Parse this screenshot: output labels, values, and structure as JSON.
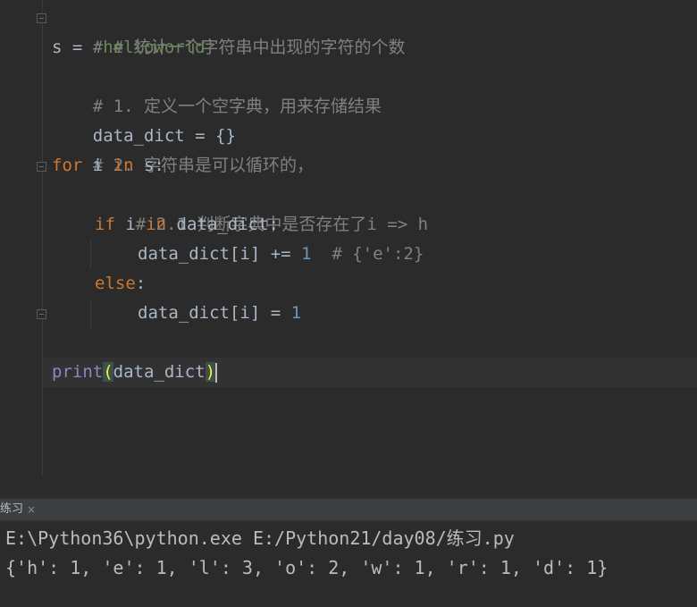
{
  "editor": {
    "lines": [
      {
        "comment": "# # 统计一个字符串中出现的字符的个数"
      },
      {
        "var": "s",
        "op": " = ",
        "str": "'helloworld'"
      },
      {
        "comment": "# 1. 定义一个空字典，用来存储结果"
      },
      {
        "text": "data_dict = {}"
      },
      {
        "comment": "# 2. 字符串是可以循环的，"
      },
      {
        "kw1": "for",
        "mid": " i ",
        "kw2": "in",
        "rest": " s:"
      },
      {
        "comment": "# 2.1 判断字典中是否存在了i => h"
      },
      {
        "kw1": "if",
        "mid": " i ",
        "kw2": "in",
        "rest": " data_dict:"
      },
      {
        "pre": "data_dict[i] += ",
        "num": "1",
        "comment": "  # {'e':2}"
      },
      {
        "kw": "else",
        "rest": ":"
      },
      {
        "pre": "data_dict[i] = ",
        "num": "1"
      },
      {
        "builtin": "print",
        "open": "(",
        "arg": "data_dict",
        "close": ")"
      }
    ]
  },
  "run_panel": {
    "tab_label": "练习",
    "close_glyph": "×",
    "output": [
      "E:\\Python36\\python.exe E:/Python21/day08/练习.py",
      "{'h': 1, 'e': 1, 'l': 3, 'o': 2, 'w': 1, 'r': 1, 'd': 1}"
    ]
  }
}
